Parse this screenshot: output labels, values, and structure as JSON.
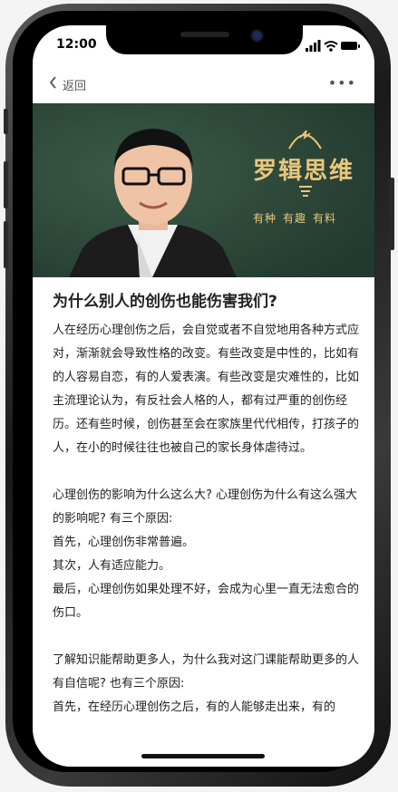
{
  "status_bar": {
    "time": "12:00"
  },
  "navbar": {
    "back_label": "返回",
    "more_label": "•••"
  },
  "banner": {
    "logo_text": "罗辑思维",
    "tags": [
      "有种",
      "有趣",
      "有料"
    ],
    "colors": {
      "background": "#2d4a3a",
      "accent": "#e8c77e"
    }
  },
  "article": {
    "title": "为什么别人的创伤也能伤害我们?",
    "paragraphs": [
      "人在经历心理创伤之后，会自觉或者不自觉地用各种方式应对，渐渐就会导致性格的改变。有些改变是中性的，比如有的人容易自恋，有的人爱表演。有些改变是灾难性的，比如主流理论认为，有反社会人格的人，都有过严重的创伤经历。还有些时候，创伤甚至会在家族里代代相传，打孩子的人，在小的时候往往也被自己的家长身体虐待过。",
      "",
      "心理创伤的影响为什么这么大? 心理创伤为什么有这么强大的影响呢? 有三个原因:",
      "首先，心理创伤非常普遍。",
      "其次，人有适应能力。",
      "最后，心理创伤如果处理不好，会成为心里一直无法愈合的伤口。",
      "",
      "了解知识能帮助更多人，为什么我对这门课能帮助更多的人有自信呢? 也有三个原因:",
      "首先，在经历心理创伤之后，有的人能够走出来，有的"
    ]
  }
}
